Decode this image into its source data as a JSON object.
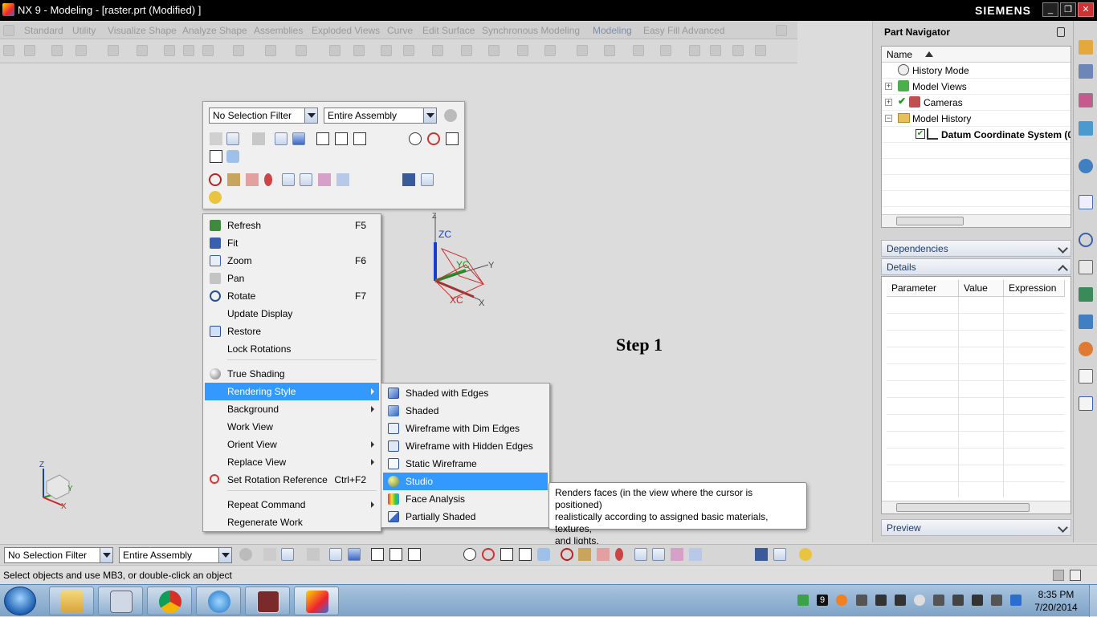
{
  "window": {
    "title": "NX 9 - Modeling - [raster.prt (Modified) ]",
    "brand": "SIEMENS",
    "min_label": "_",
    "max_label": "❐",
    "close_label": "✕"
  },
  "ribbon_tabs": [
    "Standard",
    "Utility",
    "Visualize Shape",
    "Analyze Shape",
    "Assemblies",
    "Exploded Views",
    "Curve",
    "Edit Surface",
    "Synchronous Modeling",
    "Modeling",
    "Easy Fill Advanced"
  ],
  "selection_bar": {
    "filter": "No Selection Filter",
    "scope": "Entire Assembly"
  },
  "context_menu": {
    "items": [
      {
        "label": "Refresh",
        "shortcut": "F5",
        "icon": "refresh-icon"
      },
      {
        "label": "Fit",
        "shortcut": "",
        "icon": "fit-icon"
      },
      {
        "label": "Zoom",
        "shortcut": "F6",
        "icon": "zoom-icon"
      },
      {
        "label": "Pan",
        "shortcut": "",
        "icon": "pan-icon"
      },
      {
        "label": "Rotate",
        "shortcut": "F7",
        "icon": "rotate-icon"
      },
      {
        "label": "Update Display",
        "shortcut": "",
        "icon": ""
      },
      {
        "label": "Restore",
        "shortcut": "",
        "icon": "restore-icon"
      },
      {
        "label": "Lock Rotations",
        "shortcut": "",
        "icon": ""
      },
      {
        "label": "True Shading",
        "shortcut": "",
        "icon": "true-shading-icon"
      },
      {
        "label": "Rendering Style",
        "shortcut": "",
        "icon": ""
      },
      {
        "label": "Background",
        "shortcut": "",
        "icon": ""
      },
      {
        "label": "Work View",
        "shortcut": "",
        "icon": ""
      },
      {
        "label": "Orient View",
        "shortcut": "",
        "icon": ""
      },
      {
        "label": "Replace View",
        "shortcut": "",
        "icon": ""
      },
      {
        "label": "Set Rotation Reference",
        "shortcut": "Ctrl+F2",
        "icon": "rotation-reference-icon"
      },
      {
        "label": "Repeat Command",
        "shortcut": "",
        "icon": ""
      },
      {
        "label": "Regenerate Work",
        "shortcut": "",
        "icon": ""
      }
    ]
  },
  "rendering_submenu": {
    "items": [
      {
        "label": "Shaded with Edges"
      },
      {
        "label": "Shaded"
      },
      {
        "label": "Wireframe with Dim Edges"
      },
      {
        "label": "Wireframe with Hidden Edges"
      },
      {
        "label": "Static Wireframe"
      },
      {
        "label": "Studio"
      },
      {
        "label": "Face Analysis"
      },
      {
        "label": "Partially Shaded"
      }
    ]
  },
  "tooltip": {
    "line1": "Renders faces (in the view where the cursor is positioned)",
    "line2": "realistically according to assigned basic materials, textures,",
    "line3": "and lights."
  },
  "viewport": {
    "step_label": "Step 1",
    "axis_zc": "ZC",
    "axis_yc": "YC",
    "axis_xc": "XC",
    "axis_x": "X",
    "axis_y": "Y",
    "axis_z": "Z",
    "mini_x": "X",
    "mini_y": "Y",
    "mini_z": "Z"
  },
  "part_navigator": {
    "title": "Part Navigator",
    "col_name": "Name",
    "nodes": [
      {
        "label": "History Mode"
      },
      {
        "label": "Model Views"
      },
      {
        "label": "Cameras"
      },
      {
        "label": "Model History"
      },
      {
        "label": "Datum Coordinate System (0"
      }
    ],
    "dependencies": "Dependencies",
    "details": "Details",
    "detail_cols": [
      "Parameter",
      "Value",
      "Expression"
    ],
    "preview": "Preview"
  },
  "status": {
    "message": "Select objects and use MB3, or double-click an object"
  },
  "taskbar": {
    "time": "8:35 PM",
    "date": "7/20/2014",
    "tray_badge": "9"
  },
  "colors": {
    "highlight": "#3399ff",
    "titlebar": "#000000"
  }
}
